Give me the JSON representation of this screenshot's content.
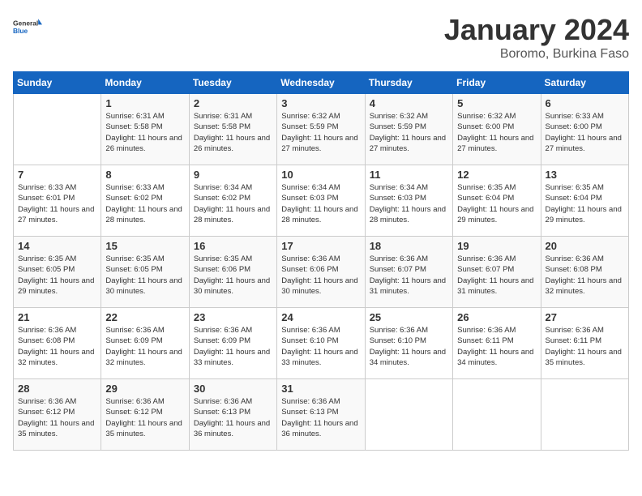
{
  "header": {
    "logo_general": "General",
    "logo_blue": "Blue",
    "month": "January 2024",
    "location": "Boromo, Burkina Faso"
  },
  "weekdays": [
    "Sunday",
    "Monday",
    "Tuesday",
    "Wednesday",
    "Thursday",
    "Friday",
    "Saturday"
  ],
  "weeks": [
    [
      {
        "day": "",
        "sunrise": "",
        "sunset": "",
        "daylight": ""
      },
      {
        "day": "1",
        "sunrise": "Sunrise: 6:31 AM",
        "sunset": "Sunset: 5:58 PM",
        "daylight": "Daylight: 11 hours and 26 minutes."
      },
      {
        "day": "2",
        "sunrise": "Sunrise: 6:31 AM",
        "sunset": "Sunset: 5:58 PM",
        "daylight": "Daylight: 11 hours and 26 minutes."
      },
      {
        "day": "3",
        "sunrise": "Sunrise: 6:32 AM",
        "sunset": "Sunset: 5:59 PM",
        "daylight": "Daylight: 11 hours and 27 minutes."
      },
      {
        "day": "4",
        "sunrise": "Sunrise: 6:32 AM",
        "sunset": "Sunset: 5:59 PM",
        "daylight": "Daylight: 11 hours and 27 minutes."
      },
      {
        "day": "5",
        "sunrise": "Sunrise: 6:32 AM",
        "sunset": "Sunset: 6:00 PM",
        "daylight": "Daylight: 11 hours and 27 minutes."
      },
      {
        "day": "6",
        "sunrise": "Sunrise: 6:33 AM",
        "sunset": "Sunset: 6:00 PM",
        "daylight": "Daylight: 11 hours and 27 minutes."
      }
    ],
    [
      {
        "day": "7",
        "sunrise": "Sunrise: 6:33 AM",
        "sunset": "Sunset: 6:01 PM",
        "daylight": "Daylight: 11 hours and 27 minutes."
      },
      {
        "day": "8",
        "sunrise": "Sunrise: 6:33 AM",
        "sunset": "Sunset: 6:02 PM",
        "daylight": "Daylight: 11 hours and 28 minutes."
      },
      {
        "day": "9",
        "sunrise": "Sunrise: 6:34 AM",
        "sunset": "Sunset: 6:02 PM",
        "daylight": "Daylight: 11 hours and 28 minutes."
      },
      {
        "day": "10",
        "sunrise": "Sunrise: 6:34 AM",
        "sunset": "Sunset: 6:03 PM",
        "daylight": "Daylight: 11 hours and 28 minutes."
      },
      {
        "day": "11",
        "sunrise": "Sunrise: 6:34 AM",
        "sunset": "Sunset: 6:03 PM",
        "daylight": "Daylight: 11 hours and 28 minutes."
      },
      {
        "day": "12",
        "sunrise": "Sunrise: 6:35 AM",
        "sunset": "Sunset: 6:04 PM",
        "daylight": "Daylight: 11 hours and 29 minutes."
      },
      {
        "day": "13",
        "sunrise": "Sunrise: 6:35 AM",
        "sunset": "Sunset: 6:04 PM",
        "daylight": "Daylight: 11 hours and 29 minutes."
      }
    ],
    [
      {
        "day": "14",
        "sunrise": "Sunrise: 6:35 AM",
        "sunset": "Sunset: 6:05 PM",
        "daylight": "Daylight: 11 hours and 29 minutes."
      },
      {
        "day": "15",
        "sunrise": "Sunrise: 6:35 AM",
        "sunset": "Sunset: 6:05 PM",
        "daylight": "Daylight: 11 hours and 30 minutes."
      },
      {
        "day": "16",
        "sunrise": "Sunrise: 6:35 AM",
        "sunset": "Sunset: 6:06 PM",
        "daylight": "Daylight: 11 hours and 30 minutes."
      },
      {
        "day": "17",
        "sunrise": "Sunrise: 6:36 AM",
        "sunset": "Sunset: 6:06 PM",
        "daylight": "Daylight: 11 hours and 30 minutes."
      },
      {
        "day": "18",
        "sunrise": "Sunrise: 6:36 AM",
        "sunset": "Sunset: 6:07 PM",
        "daylight": "Daylight: 11 hours and 31 minutes."
      },
      {
        "day": "19",
        "sunrise": "Sunrise: 6:36 AM",
        "sunset": "Sunset: 6:07 PM",
        "daylight": "Daylight: 11 hours and 31 minutes."
      },
      {
        "day": "20",
        "sunrise": "Sunrise: 6:36 AM",
        "sunset": "Sunset: 6:08 PM",
        "daylight": "Daylight: 11 hours and 32 minutes."
      }
    ],
    [
      {
        "day": "21",
        "sunrise": "Sunrise: 6:36 AM",
        "sunset": "Sunset: 6:08 PM",
        "daylight": "Daylight: 11 hours and 32 minutes."
      },
      {
        "day": "22",
        "sunrise": "Sunrise: 6:36 AM",
        "sunset": "Sunset: 6:09 PM",
        "daylight": "Daylight: 11 hours and 32 minutes."
      },
      {
        "day": "23",
        "sunrise": "Sunrise: 6:36 AM",
        "sunset": "Sunset: 6:09 PM",
        "daylight": "Daylight: 11 hours and 33 minutes."
      },
      {
        "day": "24",
        "sunrise": "Sunrise: 6:36 AM",
        "sunset": "Sunset: 6:10 PM",
        "daylight": "Daylight: 11 hours and 33 minutes."
      },
      {
        "day": "25",
        "sunrise": "Sunrise: 6:36 AM",
        "sunset": "Sunset: 6:10 PM",
        "daylight": "Daylight: 11 hours and 34 minutes."
      },
      {
        "day": "26",
        "sunrise": "Sunrise: 6:36 AM",
        "sunset": "Sunset: 6:11 PM",
        "daylight": "Daylight: 11 hours and 34 minutes."
      },
      {
        "day": "27",
        "sunrise": "Sunrise: 6:36 AM",
        "sunset": "Sunset: 6:11 PM",
        "daylight": "Daylight: 11 hours and 35 minutes."
      }
    ],
    [
      {
        "day": "28",
        "sunrise": "Sunrise: 6:36 AM",
        "sunset": "Sunset: 6:12 PM",
        "daylight": "Daylight: 11 hours and 35 minutes."
      },
      {
        "day": "29",
        "sunrise": "Sunrise: 6:36 AM",
        "sunset": "Sunset: 6:12 PM",
        "daylight": "Daylight: 11 hours and 35 minutes."
      },
      {
        "day": "30",
        "sunrise": "Sunrise: 6:36 AM",
        "sunset": "Sunset: 6:13 PM",
        "daylight": "Daylight: 11 hours and 36 minutes."
      },
      {
        "day": "31",
        "sunrise": "Sunrise: 6:36 AM",
        "sunset": "Sunset: 6:13 PM",
        "daylight": "Daylight: 11 hours and 36 minutes."
      },
      {
        "day": "",
        "sunrise": "",
        "sunset": "",
        "daylight": ""
      },
      {
        "day": "",
        "sunrise": "",
        "sunset": "",
        "daylight": ""
      },
      {
        "day": "",
        "sunrise": "",
        "sunset": "",
        "daylight": ""
      }
    ]
  ]
}
